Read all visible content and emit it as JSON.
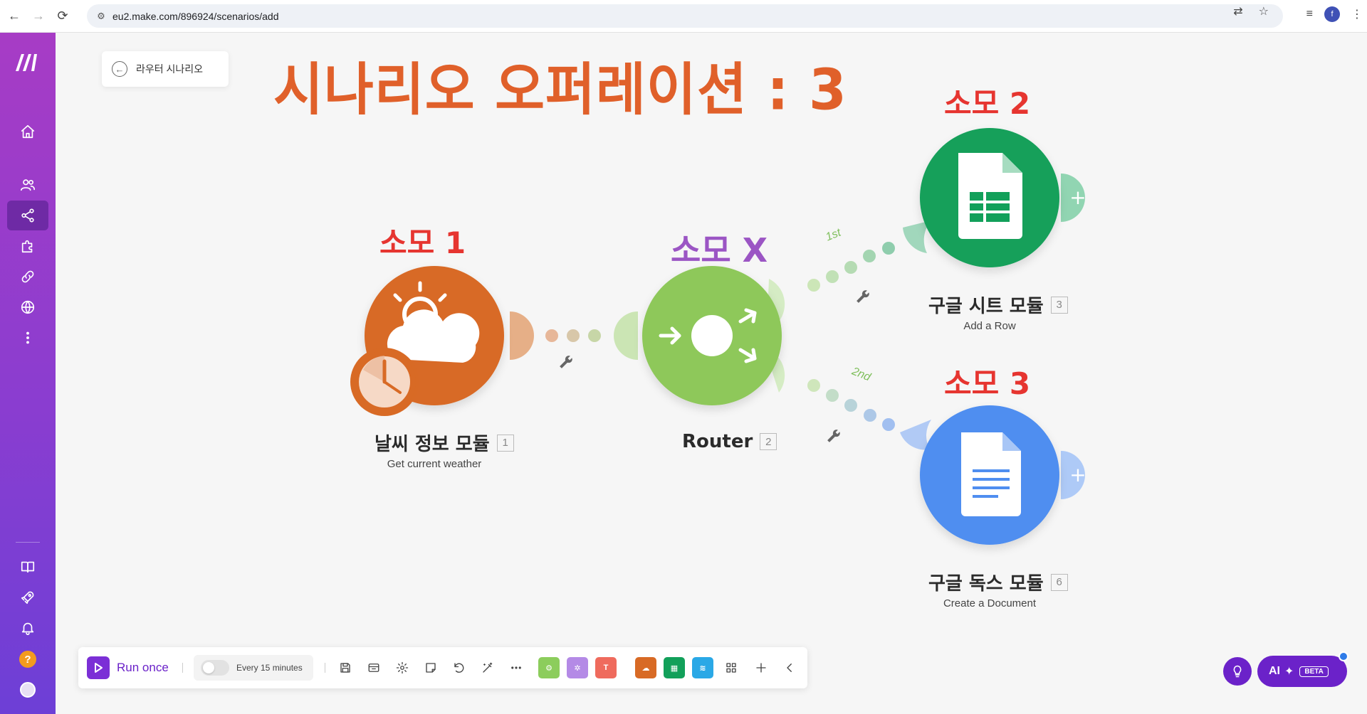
{
  "browser": {
    "url_host": "eu2.make.com",
    "url_path": "/896924/scenarios/add",
    "profile_initial": "f"
  },
  "sidebar": {
    "items": [
      {
        "icon": "home-icon"
      },
      {
        "icon": "team-icon"
      },
      {
        "icon": "scenarios-share-icon",
        "active": true
      },
      {
        "icon": "puzzle-icon"
      },
      {
        "icon": "link-icon"
      },
      {
        "icon": "globe-icon"
      },
      {
        "icon": "more-vertical-icon"
      }
    ],
    "bottom_items": [
      {
        "icon": "book-icon"
      },
      {
        "icon": "rocket-icon"
      },
      {
        "icon": "bell-icon"
      },
      {
        "icon": "help-icon",
        "label": "?"
      },
      {
        "icon": "user-avatar"
      }
    ]
  },
  "canvas": {
    "back_label": "라우터 시나리오",
    "title": "시나리오 오퍼레이션 : 3",
    "tags": {
      "tag1": "소모 1",
      "tagx": "소모 X",
      "tag2": "소모 2",
      "tag3": "소모 3"
    },
    "modules": [
      {
        "name": "날씨 정보 모듈",
        "num": "1",
        "sub": "Get current weather",
        "color": "#d86a25"
      },
      {
        "name": "Router",
        "num": "2",
        "sub": "",
        "color": "#8ec85a"
      },
      {
        "name": "구글 시트 모듈",
        "num": "3",
        "sub": "Add a Row",
        "color": "#12a05a"
      },
      {
        "name": "구글 독스 모듈",
        "num": "6",
        "sub": "Create a Document",
        "color": "#4f8ef0"
      }
    ],
    "routes": {
      "first": "1st",
      "second": "2nd"
    }
  },
  "toolbar": {
    "run_label": "Run once",
    "schedule_label": "Every 15 minutes",
    "icons": [
      "save-icon",
      "devices-icon",
      "settings-icon",
      "notes-icon",
      "undo-icon",
      "magic-wand-icon",
      "more-horizontal-icon"
    ],
    "apps": [
      {
        "icon": "tools-app-icon",
        "color": "#8ccd5c"
      },
      {
        "icon": "flow-control-app-icon",
        "color": "#b48ae6"
      },
      {
        "icon": "text-parser-app-icon",
        "color": "#ef6b5d",
        "label": "T"
      },
      {
        "icon": "weather-app-icon",
        "color": "#d86a25"
      },
      {
        "icon": "google-sheets-app-icon",
        "color": "#12a05a"
      },
      {
        "icon": "google-docs-app-icon",
        "color": "#2aa8e6"
      }
    ],
    "ai_label": "AI",
    "beta_label": "BETA"
  }
}
